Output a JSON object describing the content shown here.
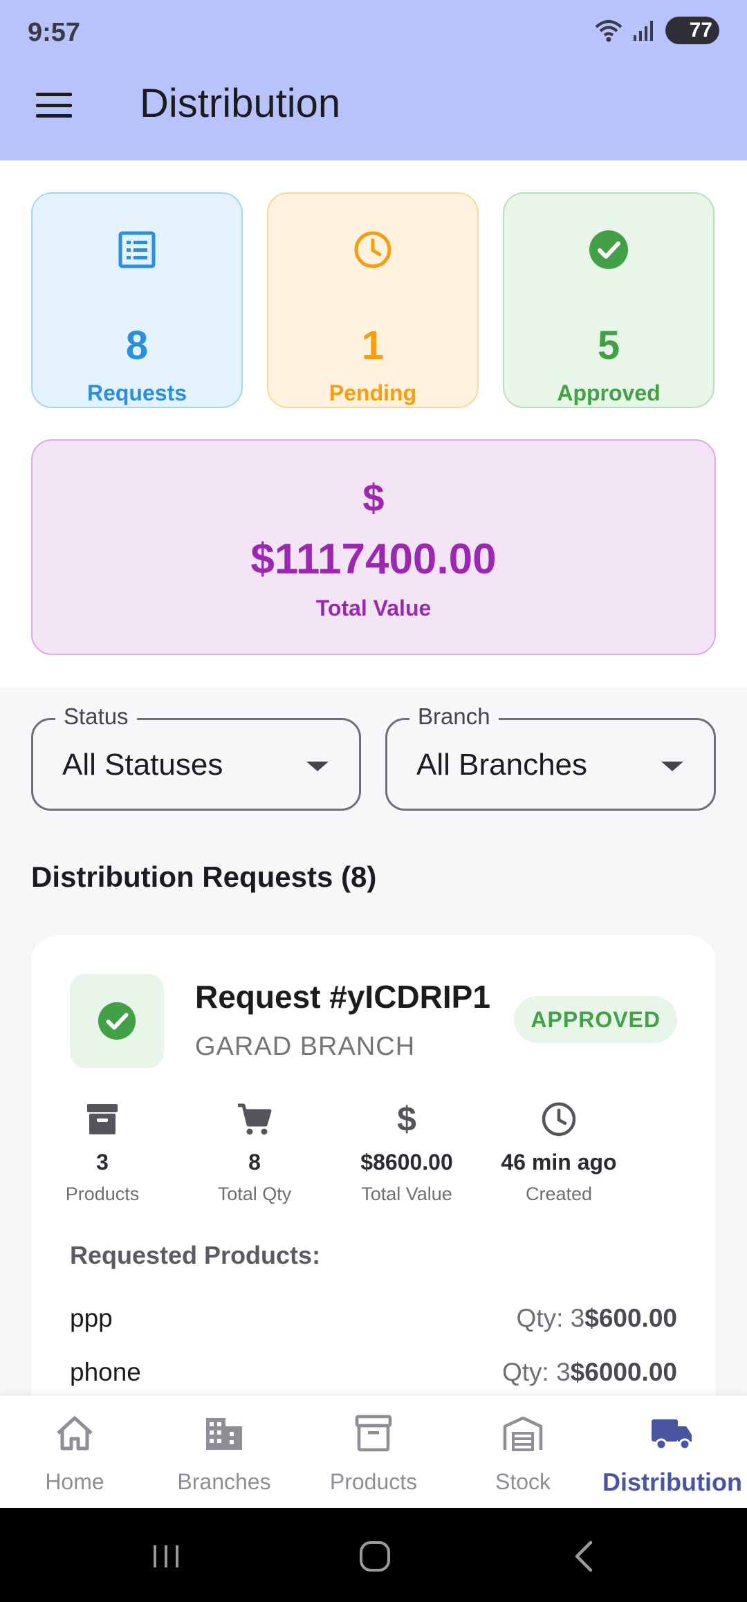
{
  "status_bar": {
    "time": "9:57",
    "battery": "77"
  },
  "header": {
    "title": "Distribution"
  },
  "summary": {
    "requests": {
      "count": "8",
      "label": "Requests",
      "color": "#2a8fde",
      "icon": "list-icon"
    },
    "pending": {
      "count": "1",
      "label": "Pending",
      "color": "#f89c12",
      "icon": "clock-icon"
    },
    "approved": {
      "count": "5",
      "label": "Approved",
      "color": "#43a047",
      "icon": "check-circle-icon"
    },
    "total": {
      "symbol": "$",
      "amount": "$1117400.00",
      "label": "Total Value",
      "color": "#9c27b0"
    }
  },
  "filters": {
    "status": {
      "label": "Status",
      "value": "All Statuses"
    },
    "branch": {
      "label": "Branch",
      "value": "All Branches"
    }
  },
  "section_title": "Distribution Requests (8)",
  "requests": [
    {
      "title": "Request #yICDRIP1",
      "branch": "GARAD BRANCH",
      "status": "APPROVED",
      "metrics": [
        {
          "value": "3",
          "label": "Products",
          "icon": "archive-icon"
        },
        {
          "value": "8",
          "label": "Total Qty",
          "icon": "cart-icon"
        },
        {
          "value": "$8600.00",
          "label": "Total Value",
          "icon": "dollar-icon"
        },
        {
          "value": "46 min ago",
          "label": "Created",
          "icon": "clock-icon"
        }
      ],
      "products_heading": "Requested Products:",
      "products": [
        {
          "name": "ppp",
          "qty": "Qty: 3",
          "price": "$600.00"
        },
        {
          "name": "phone",
          "qty": "Qty: 3",
          "price": "$6000.00"
        }
      ]
    }
  ],
  "bottom_nav": [
    {
      "label": "Home",
      "icon": "home-icon"
    },
    {
      "label": "Branches",
      "icon": "building-icon"
    },
    {
      "label": "Products",
      "icon": "archive-icon"
    },
    {
      "label": "Stock",
      "icon": "warehouse-icon"
    },
    {
      "label": "Distribution",
      "icon": "truck-icon",
      "active": true
    }
  ]
}
